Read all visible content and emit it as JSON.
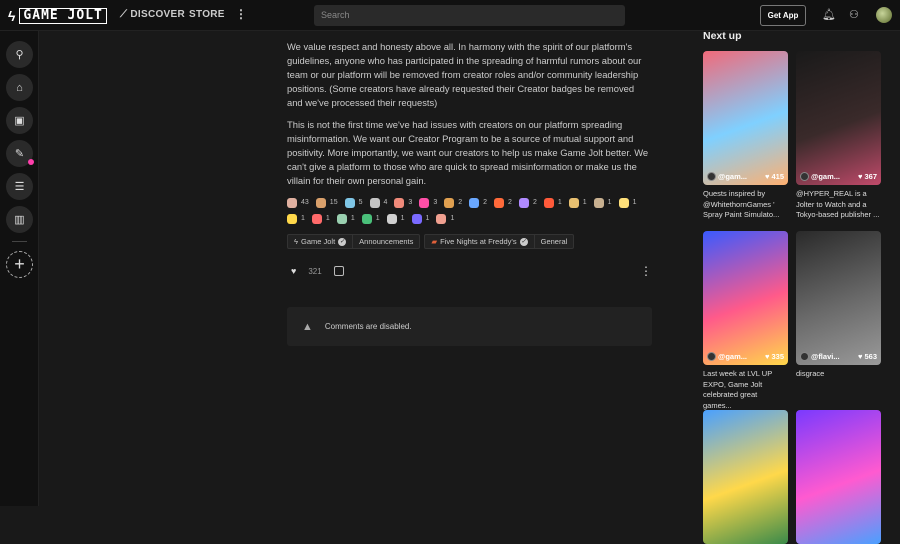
{
  "header": {
    "logo_text": "GAME JOLT",
    "nav": {
      "discover": "DISCOVER",
      "store": "STORE"
    },
    "search_placeholder": "Search",
    "get_app": "Get App"
  },
  "post": {
    "paragraphs": [
      "We value respect and honesty above all. In harmony with the spirit of our platform's guidelines, anyone who has participated in the spreading of harmful rumors about our team or our platform will be removed from creator roles and/or community leadership positions. (Some creators have already requested their Creator badges be removed and we've processed their requests)",
      "This is not the first time we've had issues with creators on our platform spreading misinformation. We want our Creator Program to be a source of mutual support and positivity. More importantly, we want our creators to help us make Game Jolt better. We can't give a platform to those who are quick to spread misinformation or make us the villain for their own personal gain."
    ],
    "reactions": [
      {
        "count": "43",
        "color": "#e0b0a0"
      },
      {
        "count": "15",
        "color": "#d9a06b"
      },
      {
        "count": "5",
        "color": "#7fc6e6"
      },
      {
        "count": "4",
        "color": "#c4c4c4"
      },
      {
        "count": "3",
        "color": "#f08a7a"
      },
      {
        "count": "3",
        "color": "#ff4fa8"
      },
      {
        "count": "2",
        "color": "#e0a050"
      },
      {
        "count": "2",
        "color": "#6aa8ff"
      },
      {
        "count": "2",
        "color": "#ff6a3a"
      },
      {
        "count": "2",
        "color": "#b08aff"
      },
      {
        "count": "1",
        "color": "#ff5a3a"
      },
      {
        "count": "1",
        "color": "#e8c070"
      },
      {
        "count": "1",
        "color": "#c8b090"
      },
      {
        "count": "1",
        "color": "#ffe07a"
      },
      {
        "count": "1",
        "color": "#ffd84a"
      },
      {
        "count": "1",
        "color": "#ff6a6a"
      },
      {
        "count": "1",
        "color": "#9ad0b0"
      },
      {
        "count": "1",
        "color": "#4ac07a"
      },
      {
        "count": "1",
        "color": "#d0d0d0"
      },
      {
        "count": "1",
        "color": "#7a6aff"
      },
      {
        "count": "1",
        "color": "#f0a090"
      }
    ],
    "tags": [
      {
        "community": "Game Jolt",
        "channel": "Announcements"
      },
      {
        "community": "Five Nights at Freddy's",
        "channel": "General"
      }
    ],
    "like_count": "321",
    "comments_disabled": "Comments are disabled."
  },
  "next_up": {
    "title": "Next up",
    "cards": [
      {
        "user": "@gam...",
        "likes": "415",
        "caption": "Quests inspired by @WhitethornGames ' Spray Paint Simulato...",
        "colors": [
          "#f06a7a",
          "#7fd0ff",
          "#ffb070"
        ]
      },
      {
        "user": "@gam...",
        "likes": "367",
        "caption": "@HYPER_REAL is a Jolter to Watch and a Tokyo-based publisher ...",
        "colors": [
          "#1a1a1a",
          "#3a2a2a",
          "#c04a6a"
        ]
      },
      {
        "user": "@gam...",
        "likes": "335",
        "caption": "Last week at LVL UP EXPO, Game Jolt celebrated great games...",
        "colors": [
          "#3a5aff",
          "#ff5a8a",
          "#ffd84a"
        ]
      },
      {
        "user": "@flavi...",
        "likes": "563",
        "caption": "disgrace",
        "colors": [
          "#2a2a2a",
          "#6a6a6a",
          "#9a9a9a"
        ]
      },
      {
        "user": "",
        "likes": "",
        "caption": "",
        "colors": [
          "#4aa0ff",
          "#ffd84a",
          "#3a8a4a"
        ]
      },
      {
        "user": "",
        "likes": "",
        "caption": "",
        "colors": [
          "#7a3aff",
          "#ff5ad0",
          "#4aa0ff"
        ]
      }
    ]
  },
  "icons": {
    "sidebar": [
      "activity-icon",
      "shop-icon",
      "backpack-icon",
      "creator-icon",
      "chat-icon",
      "library-icon"
    ]
  }
}
